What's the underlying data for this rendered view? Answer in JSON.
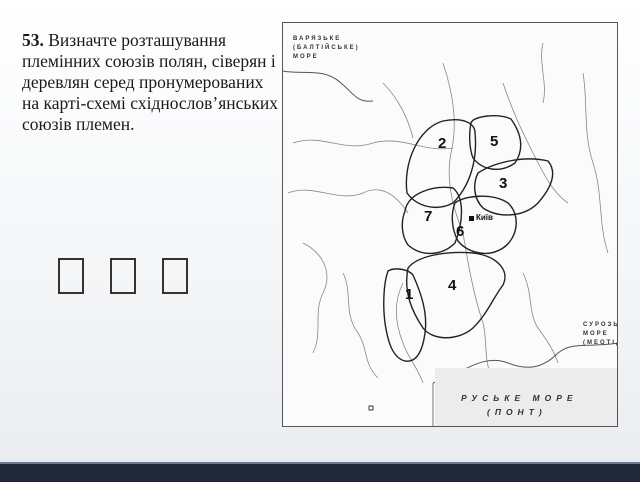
{
  "task": {
    "number": "53.",
    "text": "Визначте розташування племінних союзів полян, сіверян і деревлян серед пронумерованих на карті-схемі східнослов’янських союзів племен."
  },
  "answer_slots": [
    "",
    "",
    ""
  ],
  "map": {
    "baltic_sea": [
      "ВАРЯЗЬКЕ",
      "(БАЛТІЙСЬКЕ)",
      "МОРЕ"
    ],
    "azov_sea": [
      "СУРОЗЬКЕ",
      "МОРЕ",
      "(МЕОТІДА)"
    ],
    "black_sea": [
      "РУСЬКЕ МОРЕ",
      "(ПОНТ)"
    ],
    "city": "Київ",
    "regions": [
      "1",
      "2",
      "3",
      "4",
      "5",
      "6",
      "7"
    ]
  },
  "colors": {
    "bar": "#1f2836",
    "text": "#1a1a1a"
  }
}
